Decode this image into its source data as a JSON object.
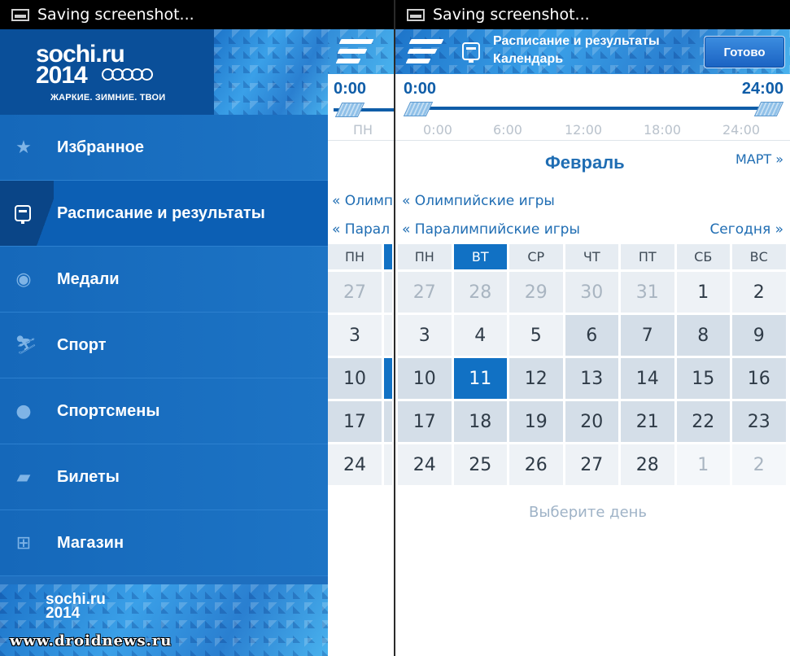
{
  "status": {
    "text": "Saving screenshot..."
  },
  "drawer": {
    "logo_line1": "sochi.ru",
    "logo_line2": "2014",
    "tagline": "ЖАРКИЕ. ЗИМНИЕ. ТВОИ",
    "items": [
      {
        "label": "Избранное",
        "icon": "star-icon",
        "glyph": "★"
      },
      {
        "label": "Расписание и результаты",
        "icon": "calendar-icon",
        "glyph": ""
      },
      {
        "label": "Медали",
        "icon": "medal-icon",
        "glyph": "◉"
      },
      {
        "label": "Спорт",
        "icon": "skier-icon",
        "glyph": "⛷"
      },
      {
        "label": "Спортсмены",
        "icon": "athlete-icon",
        "glyph": "●"
      },
      {
        "label": "Билеты",
        "icon": "ticket-icon",
        "glyph": "▰"
      },
      {
        "label": "Магазин",
        "icon": "cart-icon",
        "glyph": "⊞"
      }
    ],
    "footer_logo_line1": "sochi.ru",
    "footer_logo_line2": "2014"
  },
  "watermark": "www.droidnews.ru",
  "app": {
    "title_line1": "Расписание и результаты",
    "title_line2": "Календарь",
    "done_label": "Готово",
    "time_start": "0:00",
    "time_end": "24:00",
    "ticks": [
      "0:00",
      "6:00",
      "12:00",
      "18:00",
      "24:00"
    ],
    "month": "Февраль",
    "next_month": "МАРТ »",
    "olympic_link": "« Олимпийские игры",
    "paralympic_link": "« Паралимпийские игры",
    "today_link": "Сегодня »",
    "weekdays": [
      "ПН",
      "ВТ",
      "СР",
      "ЧТ",
      "ПТ",
      "СБ",
      "ВС"
    ],
    "days": [
      [
        "27",
        "28",
        "29",
        "30",
        "31",
        "1",
        "2"
      ],
      [
        "3",
        "4",
        "5",
        "6",
        "7",
        "8",
        "9"
      ],
      [
        "10",
        "11",
        "12",
        "13",
        "14",
        "15",
        "16"
      ],
      [
        "17",
        "18",
        "19",
        "20",
        "21",
        "22",
        "23"
      ],
      [
        "24",
        "25",
        "26",
        "27",
        "28",
        "1",
        "2"
      ]
    ],
    "hint": "Выберите день",
    "left_partial": {
      "olympic": "« Олимпи",
      "paralympic": "« Парал",
      "weekday": "ПН",
      "days": [
        "27",
        "3",
        "10",
        "17",
        "24"
      ]
    }
  },
  "colors": {
    "accent": "#1171c4",
    "drawer": "#1e6fbf"
  }
}
